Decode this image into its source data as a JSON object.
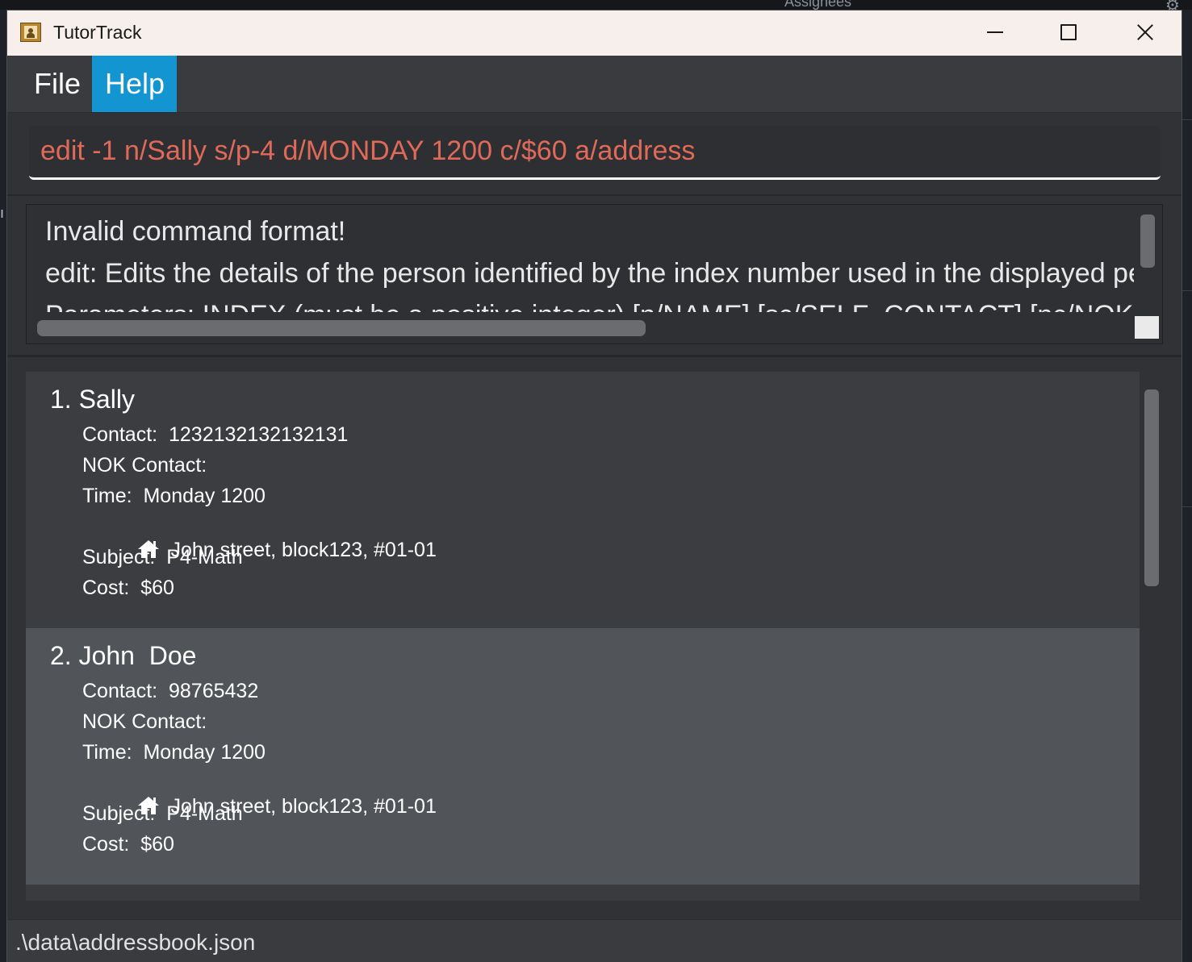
{
  "background": {
    "label": "Assignees"
  },
  "window": {
    "title": "TutorTrack"
  },
  "menu": {
    "items": [
      {
        "label": "File"
      },
      {
        "label": "Help"
      }
    ]
  },
  "command": {
    "value": "edit -1 n/Sally s/p-4 d/MONDAY 1200 c/$60 a/address",
    "text_color": "#e06a5a"
  },
  "result": {
    "lines": [
      "Invalid command format!",
      "edit: Edits the details of the person identified by the index number used in the displayed person list.",
      "Parameters: INDEX (must be a positive integer) [n/NAME] [sc/SELF_CONTACT] [nc/NOK_CONTACT]"
    ]
  },
  "persons": [
    {
      "name": "1. Sally",
      "contact": "Contact:  1232132132132131",
      "nok_contact": "NOK Contact:",
      "time": "Time:  Monday 1200",
      "address": "John street, block123, #01-01",
      "subject": "Subject:  P4-Math",
      "cost": "Cost:  $60"
    },
    {
      "name": "2. John  Doe",
      "contact": "Contact:  98765432",
      "nok_contact": "NOK Contact:",
      "time": "Time:  Monday 1200",
      "address": "John street, block123, #01-01",
      "subject": "Subject:  P4-Math",
      "cost": "Cost:  $60"
    }
  ],
  "status": {
    "path": ".\\data\\addressbook.json"
  },
  "colors": {
    "accent": "#1395d2",
    "window_bg": "#303236",
    "card_selected": "#515559"
  },
  "icons": [
    "app-icon",
    "minimize-icon",
    "maximize-icon",
    "close-icon",
    "home-icon"
  ]
}
